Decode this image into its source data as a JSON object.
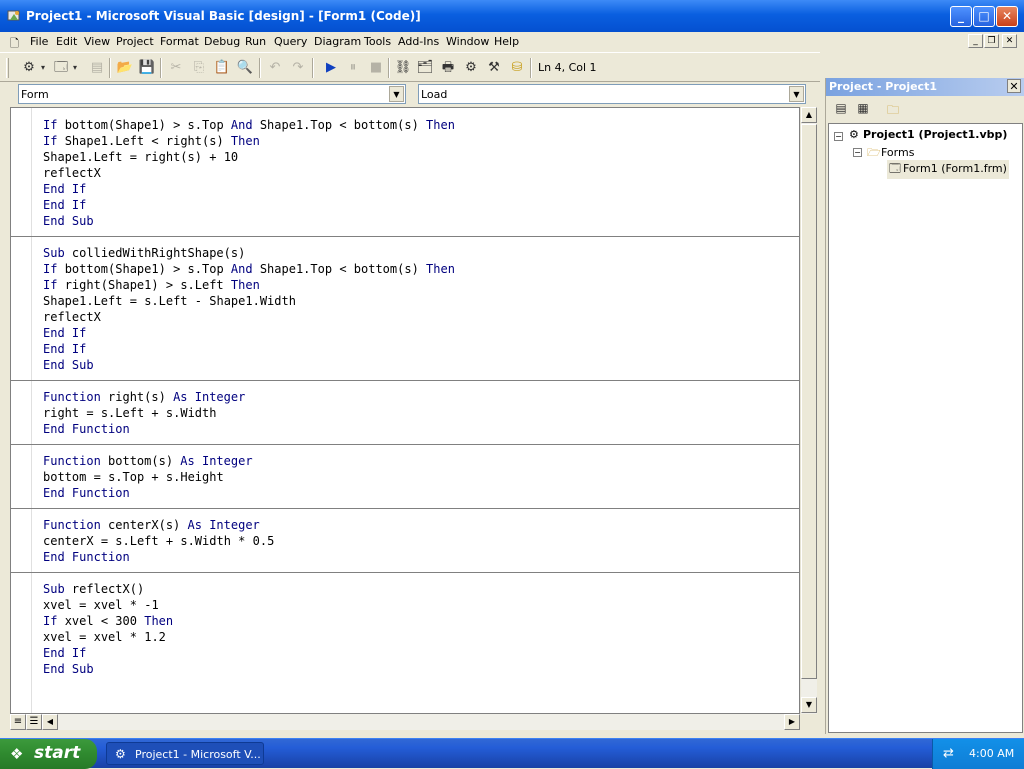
{
  "window": {
    "title": "Project1 - Microsoft Visual Basic [design] - [Form1 (Code)]",
    "minimize": "_",
    "maximize": "□",
    "close": "✕"
  },
  "menu": {
    "items": [
      "File",
      "Edit",
      "View",
      "Project",
      "Format",
      "Debug",
      "Run",
      "Query",
      "Diagram",
      "Tools",
      "Add-Ins",
      "Window",
      "Help"
    ]
  },
  "toolbar": {
    "cursor_position": "Ln 4, Col 1"
  },
  "code_window": {
    "object_combo": "Form",
    "procedure_combo": "Load",
    "lines": [
      {
        "t": "If bottom(Shape1) > s.Top And Shape1.Top < bottom(s) Then",
        "k": "code"
      },
      {
        "t": "If Shape1.Left < right(s) Then",
        "k": "code"
      },
      {
        "t": "Shape1.Left = right(s) + 10",
        "k": "code"
      },
      {
        "t": "reflectX",
        "k": "code"
      },
      {
        "t": "End If",
        "k": "code"
      },
      {
        "t": "End If",
        "k": "code"
      },
      {
        "t": "End Sub",
        "k": "code"
      },
      {
        "t": "",
        "k": "sep"
      },
      {
        "t": "Sub colliedWithRightShape(s)",
        "k": "code"
      },
      {
        "t": "If bottom(Shape1) > s.Top And Shape1.Top < bottom(s) Then",
        "k": "code"
      },
      {
        "t": "If right(Shape1) > s.Left Then",
        "k": "code"
      },
      {
        "t": "Shape1.Left = s.Left - Shape1.Width",
        "k": "code"
      },
      {
        "t": "reflectX",
        "k": "code"
      },
      {
        "t": "End If",
        "k": "code"
      },
      {
        "t": "End If",
        "k": "code"
      },
      {
        "t": "End Sub",
        "k": "code"
      },
      {
        "t": "",
        "k": "sep"
      },
      {
        "t": "Function right(s) As Integer",
        "k": "code"
      },
      {
        "t": "right = s.Left + s.Width",
        "k": "code"
      },
      {
        "t": "End Function",
        "k": "code"
      },
      {
        "t": "",
        "k": "sep"
      },
      {
        "t": "Function bottom(s) As Integer",
        "k": "code"
      },
      {
        "t": "bottom = s.Top + s.Height",
        "k": "code"
      },
      {
        "t": "End Function",
        "k": "code"
      },
      {
        "t": "",
        "k": "sep"
      },
      {
        "t": "Function centerX(s) As Integer",
        "k": "code"
      },
      {
        "t": "centerX = s.Left + s.Width * 0.5",
        "k": "code"
      },
      {
        "t": "End Function",
        "k": "code"
      },
      {
        "t": "",
        "k": "sep"
      },
      {
        "t": "Sub reflectX()",
        "k": "code"
      },
      {
        "t": "xvel = xvel * -1",
        "k": "code"
      },
      {
        "t": "If xvel < 300 Then",
        "k": "code"
      },
      {
        "t": "xvel = xvel * 1.2",
        "k": "code"
      },
      {
        "t": "End If",
        "k": "code"
      },
      {
        "t": "End Sub",
        "k": "code"
      }
    ],
    "keywords": [
      "If",
      "Then",
      "And",
      "End",
      "Sub",
      "Function",
      "As",
      "Integer"
    ]
  },
  "project_explorer": {
    "title": "Project - Project1",
    "project": "Project1 (Project1.vbp)",
    "folder": "Forms",
    "form": "Form1 (Form1.frm)"
  },
  "taskbar": {
    "start_label": "start",
    "task_label": "Project1 - Microsoft V...",
    "clock": "4:00 AM"
  },
  "colors": {
    "keyword": "#00007f",
    "titlebar": "#0a5fe0",
    "taskbar": "#245dd7",
    "start": "#2f8a2f"
  }
}
